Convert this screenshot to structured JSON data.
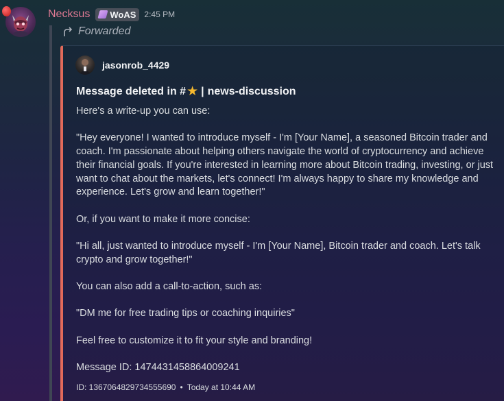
{
  "author": {
    "name": "Necksus",
    "tag": "WoAS",
    "time": "2:45 PM"
  },
  "forward": {
    "label": "Forwarded"
  },
  "embed": {
    "user": "jasonrob_4429",
    "title_prefix": "Message deleted in #",
    "title_emoji": "★",
    "title_separator": "|",
    "title_channel": "news-discussion",
    "paragraphs": [
      "Here's a write-up you can use:",
      "\"Hey everyone! I wanted to introduce myself - I'm [Your Name], a seasoned Bitcoin trader and coach. I'm passionate about helping others navigate the world of cryptocurrency and achieve their financial goals. If you're interested in learning more about Bitcoin trading, investing, or just want to chat about the markets, let's connect! I'm always happy to share my knowledge and experience. Let's grow and learn together!\"",
      "Or, if you want to make it more concise:",
      "\"Hi all, just wanted to introduce myself - I'm [Your Name], Bitcoin trader and coach. Let's talk crypto and grow together!\"",
      "You can also add a call-to-action, such as:",
      "\"DM me for free trading tips or coaching inquiries\"",
      "Feel free to customize it to fit your style and branding!",
      "Message ID: 1474431458864009241"
    ],
    "footer_id": "ID: 1367064829734555690",
    "footer_separator": "•",
    "footer_time": "Today at 10:44 AM"
  },
  "colors": {
    "username": "#e07a94",
    "embed_border": "#e26a5a",
    "star": "#f5b82e"
  }
}
